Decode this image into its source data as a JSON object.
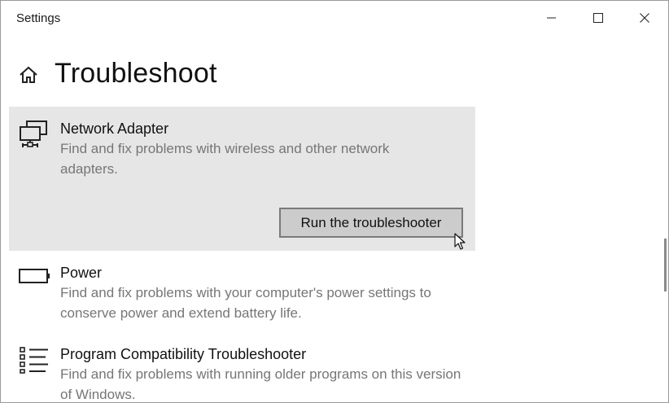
{
  "window": {
    "app_title": "Settings",
    "controls": {
      "minimize_icon": "minimize-icon",
      "maximize_icon": "maximize-icon",
      "close_icon": "close-icon"
    }
  },
  "header": {
    "home_icon": "home-icon",
    "title": "Troubleshoot"
  },
  "troubleshooters": [
    {
      "icon": "network-adapter-icon",
      "title": "Network Adapter",
      "description": "Find and fix problems with wireless and other network adapters.",
      "selected": true,
      "action_label": "Run the troubleshooter"
    },
    {
      "icon": "battery-icon",
      "title": "Power",
      "description": "Find and fix problems with your computer's power settings to conserve power and extend battery life.",
      "selected": false
    },
    {
      "icon": "list-icon",
      "title": "Program Compatibility Troubleshooter",
      "description": "Find and fix problems with running older programs on this version of Windows.",
      "selected": false
    }
  ],
  "colors": {
    "selected_background": "#e6e6e6",
    "description_text": "#767676",
    "button_background": "#cccccc",
    "button_border": "#7a7a7a"
  }
}
